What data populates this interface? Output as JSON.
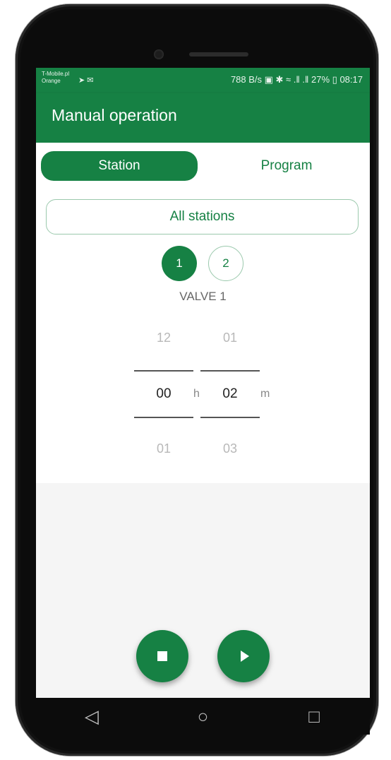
{
  "status_bar": {
    "carrier_line1": "T-Mobile.pl",
    "carrier_line2": "Orange",
    "left_icons": "➤ ✉",
    "speed": "788 B/s",
    "icons": "▣ ✱ ≈ .‖ .‖",
    "battery_percent": "27%",
    "time": "08:17"
  },
  "app_bar": {
    "title": "Manual operation"
  },
  "tabs": {
    "station": "Station",
    "program": "Program"
  },
  "station_selector": {
    "all_stations_label": "All stations",
    "stations": [
      "1",
      "2"
    ],
    "selected_station": "1",
    "valve_name": "VALVE 1"
  },
  "time_picker": {
    "hours_prev": "12",
    "hours_value": "00",
    "hours_next": "01",
    "hours_unit": "h",
    "minutes_prev": "01",
    "minutes_value": "02",
    "minutes_next": "03",
    "minutes_unit": "m"
  },
  "controls": {
    "stop_icon": "stop-icon",
    "play_icon": "play-icon"
  },
  "nav_bar": {
    "back": "◁",
    "home": "○",
    "recents": "□"
  },
  "colors": {
    "primary": "#168144",
    "primary_border": "#9bc9ad",
    "background": "#f5f5f5"
  }
}
